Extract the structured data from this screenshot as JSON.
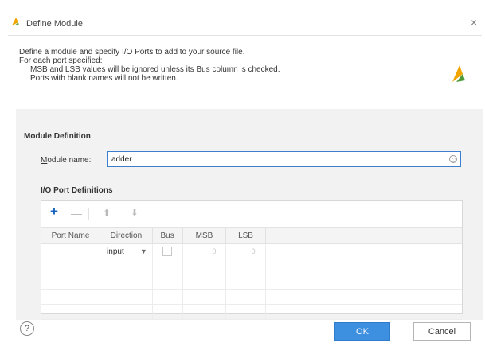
{
  "window": {
    "title": "Define Module",
    "close_glyph": "×",
    "logo_icon": "vivado-logo-icon",
    "accent": "#f0a500"
  },
  "intro": {
    "line1": "Define a module and specify I/O Ports to add to your source file.",
    "line2": "For each port specified:",
    "line3": "MSB and LSB values will be ignored unless its Bus column is checked.",
    "line4": "Ports with blank names will not be written."
  },
  "module_definition": {
    "section_title": "Module Definition",
    "name_label_mnemonic": "M",
    "name_label_rest": "odule name:",
    "name_value": "adder"
  },
  "io_ports": {
    "section_title": "I/O Port Definitions",
    "toolbar": {
      "add": "+",
      "remove": "—",
      "move_up": "⬆",
      "move_down": "⬇"
    },
    "columns": [
      "Port Name",
      "Direction",
      "Bus",
      "MSB",
      "LSB"
    ],
    "rows": [
      {
        "port_name": "",
        "direction": "input",
        "bus": false,
        "msb": "0",
        "lsb": "0"
      }
    ]
  },
  "footer": {
    "help_glyph": "?",
    "ok_label": "OK",
    "cancel_label": "Cancel",
    "ok_color": "#3d8fe0"
  }
}
